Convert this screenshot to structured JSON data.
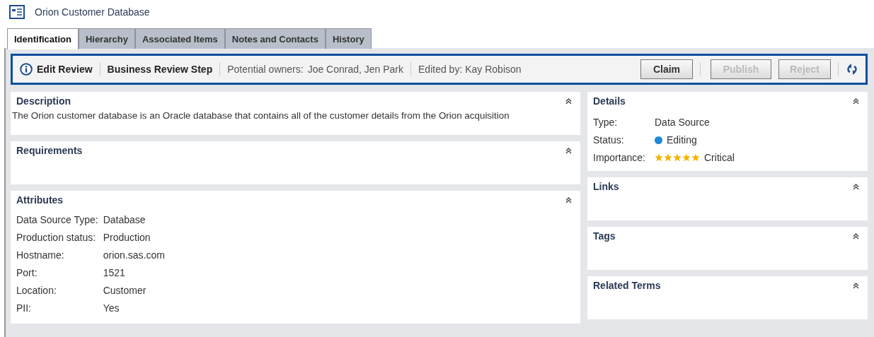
{
  "window": {
    "title": "Orion Customer Database"
  },
  "tabs": [
    {
      "label": "Identification",
      "selected": true
    },
    {
      "label": "Hierarchy",
      "selected": false
    },
    {
      "label": "Associated Items",
      "selected": false
    },
    {
      "label": "Notes and Contacts",
      "selected": false
    },
    {
      "label": "History",
      "selected": false
    }
  ],
  "review_bar": {
    "title": "Edit Review",
    "step": "Business Review Step",
    "owners_label": "Potential owners:",
    "owners": "Joe Conrad, Jen Park",
    "edited_by": "Edited by: Kay Robison",
    "buttons": [
      {
        "label": "Claim",
        "disabled": false
      },
      {
        "label": "Publish",
        "disabled": true
      },
      {
        "label": "Reject",
        "disabled": true
      }
    ]
  },
  "left_panels": [
    {
      "kind": "text",
      "title": "Description",
      "text": "The Orion customer database is an Oracle database that contains all of the customer details from the Orion acquisition"
    },
    {
      "kind": "empty",
      "title": "Requirements"
    },
    {
      "kind": "fields",
      "title": "Attributes",
      "fields": [
        {
          "label": "Data Source Type:",
          "value": "Database"
        },
        {
          "label": "Production status:",
          "value": "Production"
        },
        {
          "label": "Hostname:",
          "value": "orion.sas.com"
        },
        {
          "label": "Port:",
          "value": "1521"
        },
        {
          "label": "Location:",
          "value": "Customer"
        },
        {
          "label": "PII:",
          "value": "Yes"
        }
      ]
    }
  ],
  "right_panels": [
    {
      "kind": "details",
      "title": "Details",
      "type_label": "Type:",
      "type": "Data Source",
      "status_label": "Status:",
      "status": "Editing",
      "importance_label": "Importance:",
      "stars": 5,
      "importance": "Critical"
    },
    {
      "kind": "empty",
      "title": "Links"
    },
    {
      "kind": "empty",
      "title": "Tags"
    },
    {
      "kind": "empty",
      "title": "Related Terms"
    }
  ]
}
